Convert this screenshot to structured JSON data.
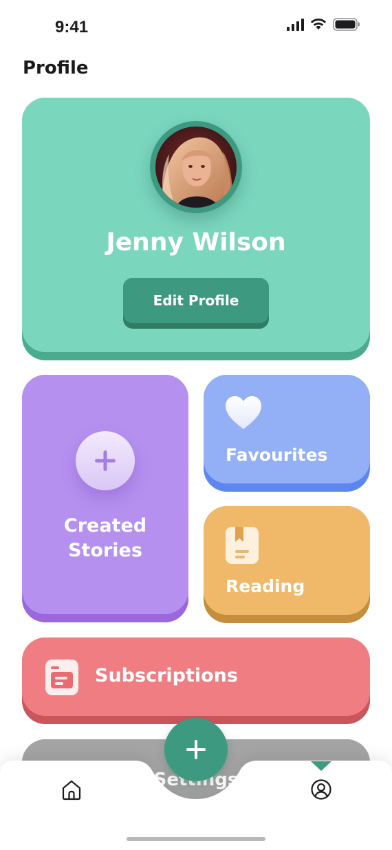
{
  "status_bar": {
    "time": "9:41"
  },
  "header": {
    "title": "Profile"
  },
  "profile": {
    "name": "Jenny Wilson",
    "edit_label": "Edit Profile"
  },
  "tiles": {
    "created": {
      "line1": "Created",
      "line2": "Stories",
      "icon": "plus-icon"
    },
    "favourites": {
      "label": "Favourites",
      "icon": "heart-icon"
    },
    "reading": {
      "label": "Reading",
      "icon": "bookmark-book-icon"
    },
    "subscriptions": {
      "label": "Subscriptions",
      "icon": "subscription-card-icon"
    },
    "settings": {
      "label": "Settings"
    }
  },
  "nav": {
    "items": [
      {
        "icon": "home-icon"
      },
      {
        "icon": "plus-icon"
      },
      {
        "icon": "profile-icon"
      }
    ]
  },
  "colors": {
    "profile_card": "#7bd6be",
    "created_card": "#b590ef",
    "favourites_card": "#93aff5",
    "reading_card": "#f0b96a",
    "subscriptions_card": "#ef7d82",
    "accent_green": "#3d9a80"
  }
}
